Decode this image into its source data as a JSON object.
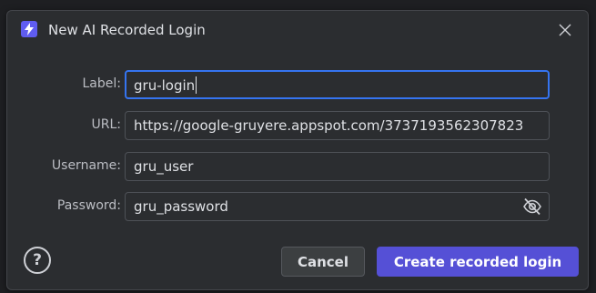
{
  "dialog": {
    "title": "New AI Recorded Login",
    "app_icon": "lightning-bolt-icon",
    "close_icon": "close-icon"
  },
  "form": {
    "label": {
      "caption": "Label:",
      "value": "gru-login"
    },
    "url": {
      "caption": "URL:",
      "value": "https://google-gruyere.appspot.com/3737193562307823"
    },
    "username": {
      "caption": "Username:",
      "value": "gru_user"
    },
    "password": {
      "caption": "Password:",
      "value": "gru_password",
      "toggle_icon": "eye-hidden-icon"
    }
  },
  "footer": {
    "help_icon": "question-mark-icon",
    "help_glyph": "?",
    "cancel_label": "Cancel",
    "create_label": "Create recorded login"
  },
  "colors": {
    "accent": "#5550d6",
    "focus": "#3574f0",
    "background": "#2b2d30"
  }
}
